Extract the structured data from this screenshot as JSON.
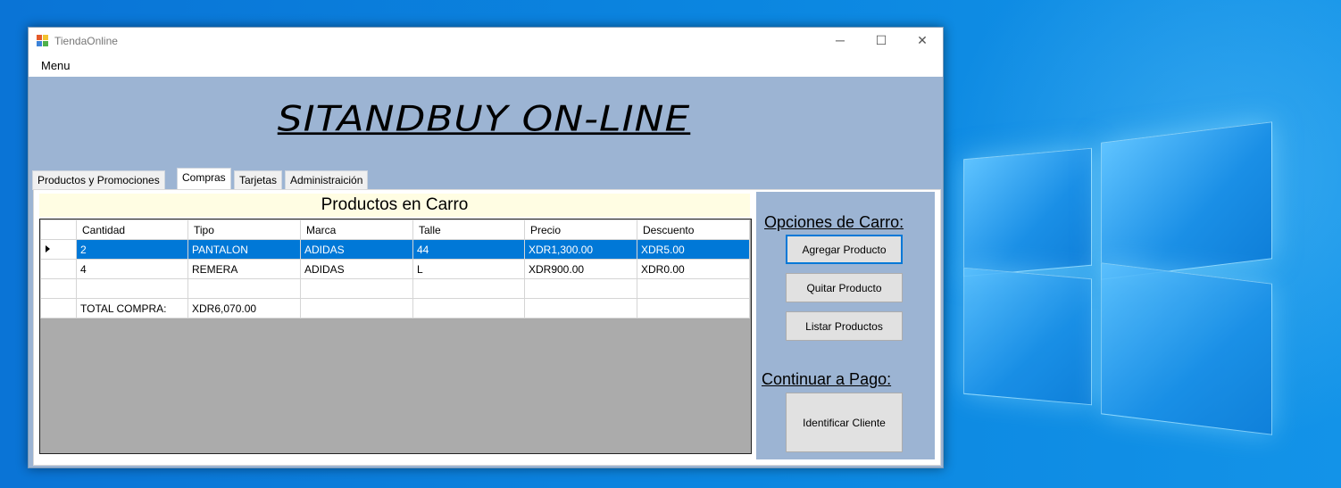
{
  "window": {
    "title": "TiendaOnline",
    "minimize_glyph": "─",
    "maximize_glyph": "☐",
    "close_glyph": "✕"
  },
  "menubar": {
    "menu_label": "Menu"
  },
  "banner": {
    "text": "SITANDBUY ON-LINE"
  },
  "tabs": [
    {
      "label": "Productos y Promociones"
    },
    {
      "label": "Compras"
    },
    {
      "label": "Tarjetas"
    },
    {
      "label": "Administraición"
    }
  ],
  "active_tab": "Compras",
  "cart": {
    "title": "Productos en Carro",
    "columns": [
      "Cantidad",
      "Tipo",
      "Marca",
      "Talle",
      "Precio",
      "Descuento"
    ],
    "rows": [
      [
        "2",
        "PANTALON",
        "ADIDAS",
        "44",
        "XDR1,300.00",
        "XDR5.00"
      ],
      [
        "4",
        "REMERA",
        "ADIDAS",
        "L",
        "XDR900.00",
        "XDR0.00"
      ],
      [
        "",
        "",
        "",
        "",
        "",
        ""
      ],
      [
        "TOTAL COMPRA:",
        "XDR6,070.00",
        "",
        "",
        "",
        ""
      ]
    ],
    "selected_row": 0
  },
  "side": {
    "cart_options_label": "Opciones de Carro:",
    "add_product": "Agregar Producto",
    "remove_product": "Quitar Producto",
    "list_products": "Listar Productos",
    "continue_label": "Continuar a Pago:",
    "identify_client": "Identificar Cliente"
  },
  "colors": {
    "selection": "#0078d7",
    "client_bg": "#9cb4d3",
    "grid_bg": "#ababab",
    "title_bg": "#fffde3"
  }
}
